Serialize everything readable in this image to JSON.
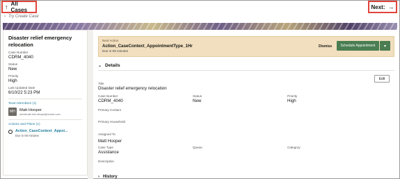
{
  "topbar": {
    "all_cases": "All Cases",
    "next": "Next:",
    "up_arrow": "↑",
    "right_arrow": "→"
  },
  "try_create": "Try Create Case",
  "case": {
    "title": "Disaster relief emergency relocation",
    "case_number_label": "Case Number",
    "case_number": "CDRM_4040",
    "status_label": "Status",
    "status": "New",
    "priority_label": "Priority",
    "priority": "High",
    "last_updated_label": "Last Updated Date",
    "last_updated": "6/10/22 5:23 PM"
  },
  "team": {
    "header": "Team Members (1)",
    "member_initials": "MH",
    "member_name": "Matt Hooper",
    "member_email": "servdmail-test-ofsopd@oracle.com"
  },
  "actions": {
    "header": "Actions and Plans (1)",
    "item_name": "Action_CaseContext_Appoi...",
    "item_due": "Due in 59 minutes"
  },
  "next_action": {
    "label": "Next Action",
    "title": "Action_CaseContext_AppointmentType_1Hr",
    "due": "Due in 59 minutes",
    "dismiss": "Dismiss",
    "schedule": "Schedule Appointment"
  },
  "details": {
    "header": "Details",
    "edit": "Edit",
    "title_label": "Title",
    "title_value": "Disaster relief emergency relocation",
    "case_number_label": "Case Number",
    "case_number_value": "CDRM_4040",
    "status_label": "Status",
    "status_value": "New",
    "priority_label": "Priority",
    "priority_value": "High",
    "primary_contact_label": "Primary Contact",
    "primary_household_label": "Primary Household",
    "assigned_to_label": "Assigned To",
    "assigned_to_value": "Matt Hooper",
    "case_type_label": "Case Type",
    "case_type_value": "Assistance",
    "queue_label": "Queue",
    "category_label": "Category",
    "description_label": "Description"
  },
  "history": {
    "header": "History"
  },
  "colors": {
    "highlight_border": "#e0433b",
    "link": "#227e9e",
    "primary_button": "#4a7d52",
    "next_action_bg": "#f1dfbf"
  }
}
